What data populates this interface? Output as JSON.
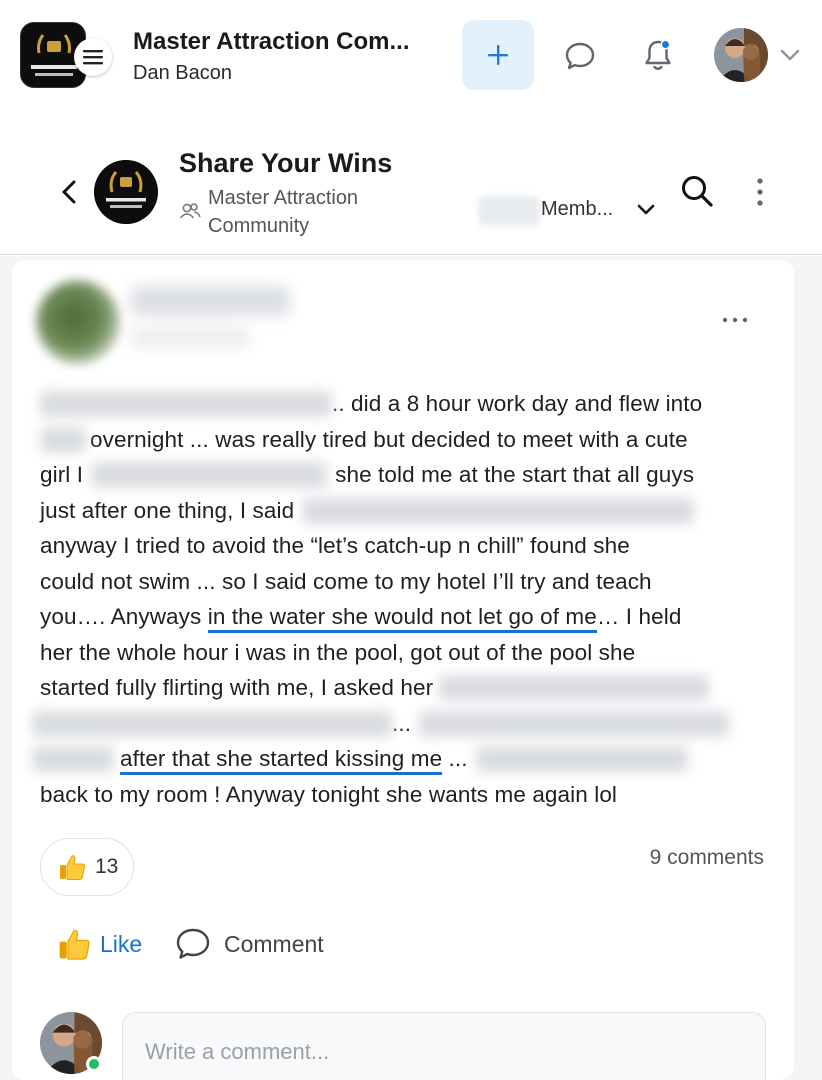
{
  "appbar": {
    "title": "Master Attraction Com...",
    "subtitle": "Dan Bacon",
    "add_icon": "plus-icon",
    "chat_icon": "chat-bubble-icon",
    "notifications_icon": "bell-icon",
    "accent": "#1a7ad8"
  },
  "group": {
    "title": "Share Your Wins",
    "community": "Master Attraction Community",
    "members_label": "Memb..."
  },
  "post": {
    "lines": [
      {
        "pre_blur": true,
        "text": ".. did a 8 hour work day and flew into"
      },
      {
        "pre_blur": true,
        "text": "overnight ... was really tired but decided to meet with a cute"
      },
      {
        "a": "girl I",
        "b": "she told me  at the start that all guys"
      },
      {
        "a": "just after one thing, I said"
      },
      {
        "a": "anyway I tried to avoid the “let’s catch-up n chill” found she"
      },
      {
        "a": "could not swim ... so I said come to my hotel I’ll try and teach"
      },
      {
        "a": "you…. Anyways ",
        "hl": "in the water she would not  let go of me",
        "b": "… I held"
      },
      {
        "a": "her the whole hour i was in the pool, got out of the pool she"
      },
      {
        "a": "started fully flirting with me, I asked her"
      },
      {
        "a": "..."
      },
      {
        "hl": "after that she started kissing me",
        "b": " ..."
      },
      {
        "a": "back to my room ! Anyway tonight she wants me again lol"
      }
    ],
    "reaction_count": "13",
    "comments_count": "9 comments",
    "like_label": "Like",
    "comment_label": "Comment",
    "comment_placeholder": "Write a comment...",
    "highlight_color": "#1a6fd1",
    "online_color": "#1dbf60"
  }
}
